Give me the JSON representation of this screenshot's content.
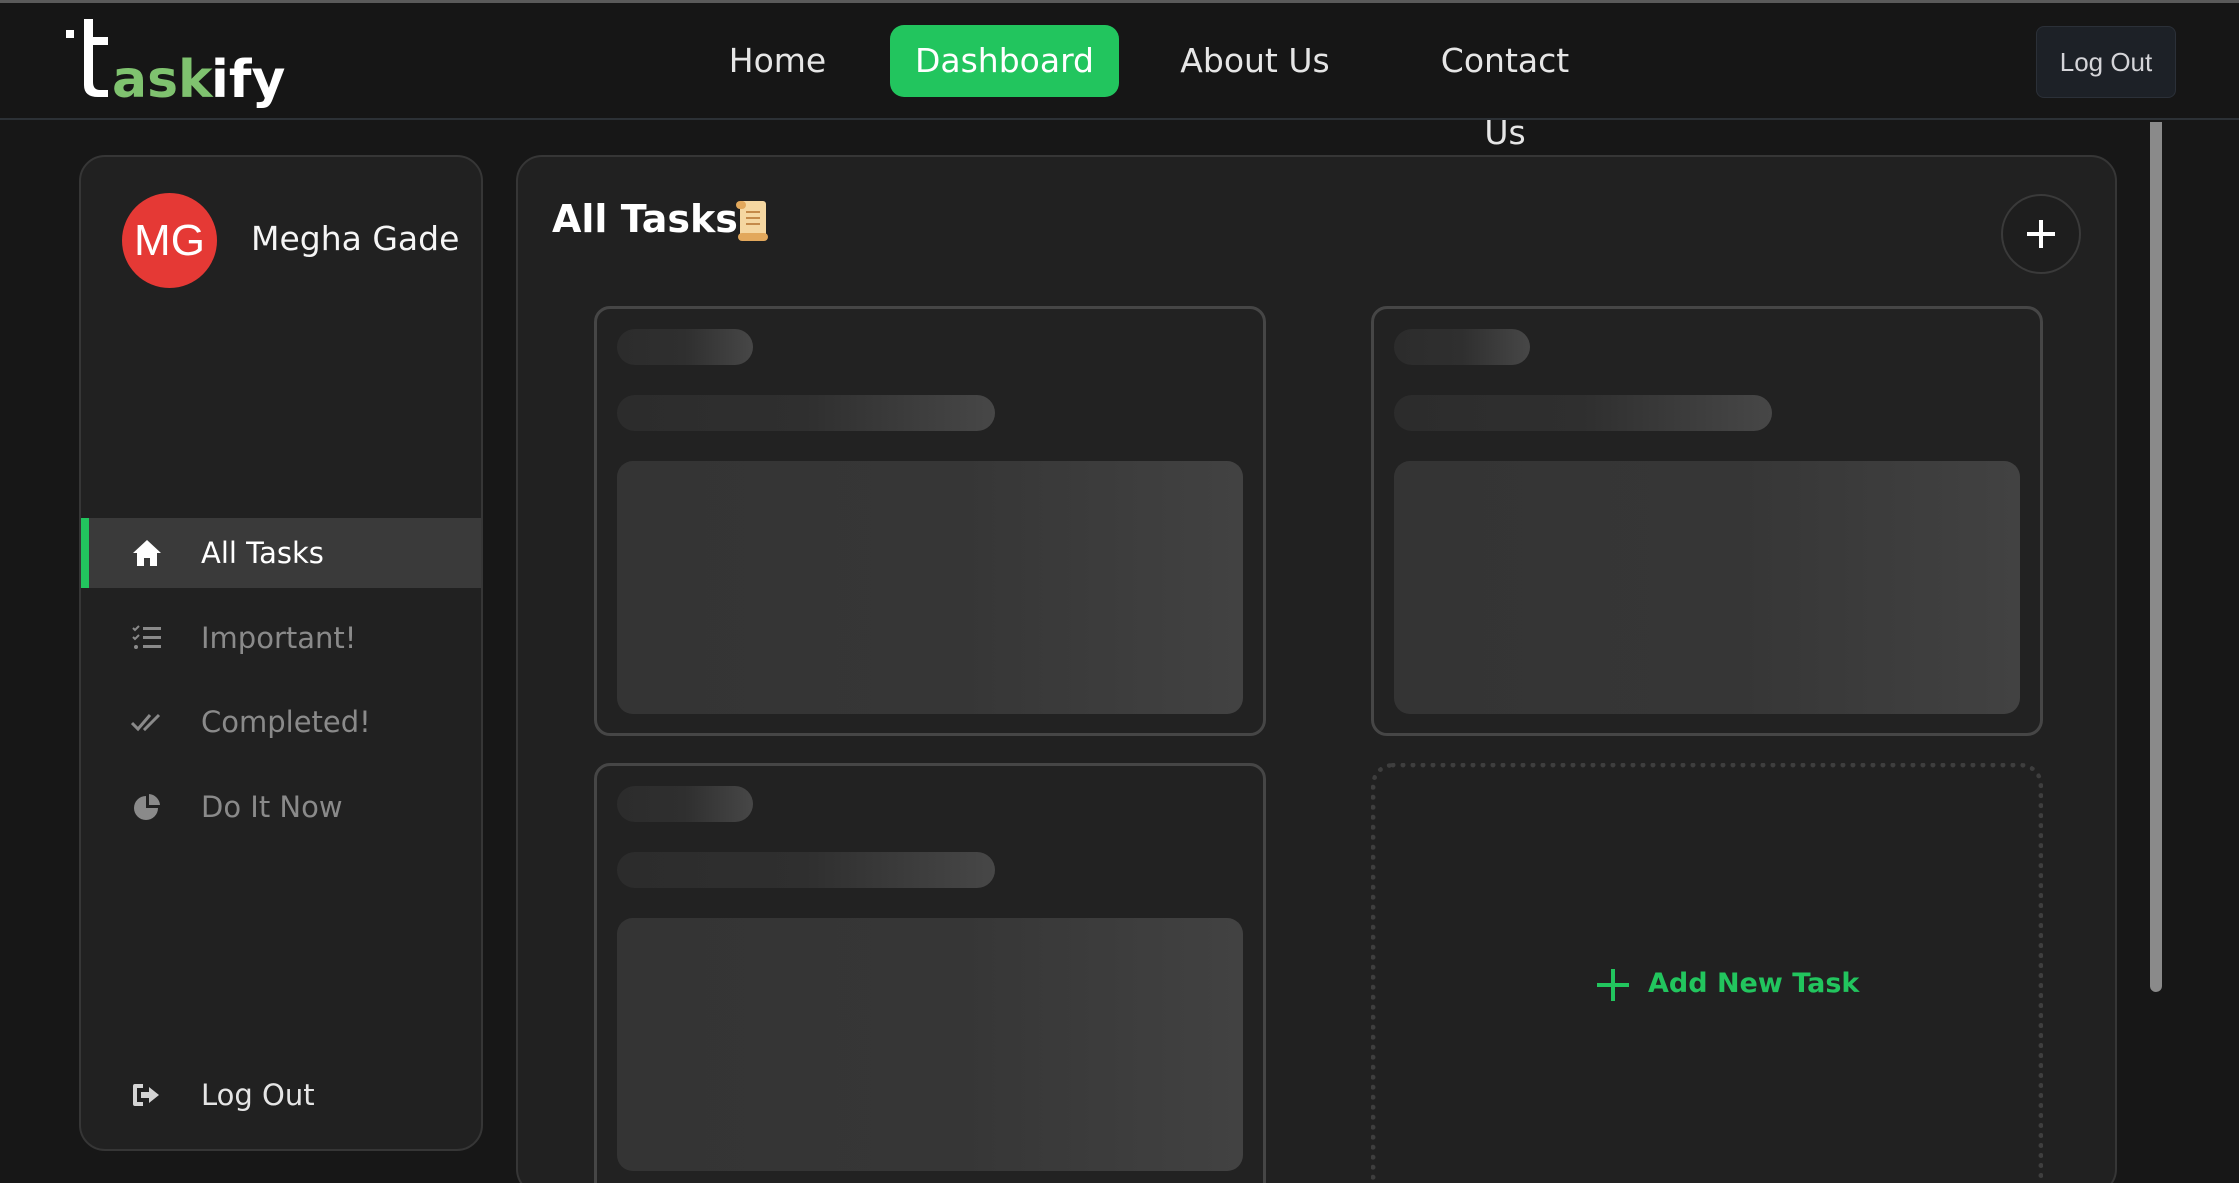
{
  "brand": {
    "name": "taskify",
    "accent": "#22c55e"
  },
  "navbar": {
    "links": [
      {
        "label": "Home"
      },
      {
        "label": "Dashboard",
        "active": true
      },
      {
        "label": "About Us"
      },
      {
        "label": "Contact Us"
      }
    ],
    "logout_label": "Log Out"
  },
  "sidebar": {
    "user": {
      "initials": "MG",
      "name": "Megha Gade",
      "avatar_color": "#e53935"
    },
    "items": [
      {
        "label": "All Tasks",
        "icon": "home-icon",
        "active": true
      },
      {
        "label": "Important!",
        "icon": "list-check-icon"
      },
      {
        "label": "Completed!",
        "icon": "double-check-icon"
      },
      {
        "label": "Do It Now",
        "icon": "pie-chart-icon"
      }
    ],
    "logout_label": "Log Out"
  },
  "main": {
    "title": "All Tasks",
    "title_icon": "scroll-icon",
    "add_new_label": "Add New Task"
  }
}
